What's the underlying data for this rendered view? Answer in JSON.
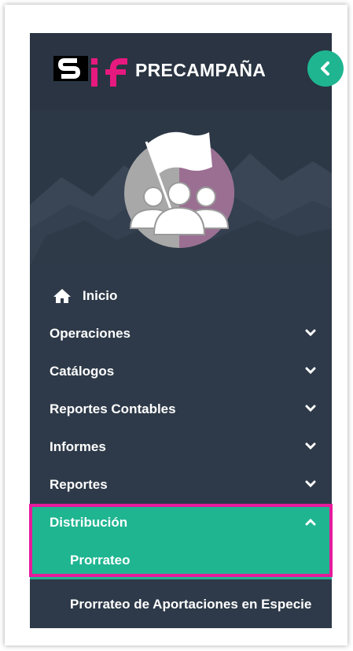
{
  "header": {
    "brand_title": "PRECAMPAÑA",
    "logo_icon": "sif-logo-icon",
    "collapse_icon": "chevron-left-icon"
  },
  "hero": {
    "icon": "flag-with-people-icon"
  },
  "menu": {
    "items": [
      {
        "label": "Inicio",
        "icon": "home-icon"
      },
      {
        "label": "Operaciones",
        "icon": "chevron-down-icon"
      },
      {
        "label": "Catálogos",
        "icon": "chevron-down-icon"
      },
      {
        "label": "Reportes Contables",
        "icon": "chevron-down-icon"
      },
      {
        "label": "Informes",
        "icon": "chevron-down-icon"
      },
      {
        "label": "Reportes",
        "icon": "chevron-down-icon"
      },
      {
        "label": "Distribución",
        "icon": "chevron-up-icon"
      }
    ],
    "subitems": [
      {
        "label": "Prorrateo"
      },
      {
        "label": "Prorrateo de Aportaciones en Especie"
      }
    ]
  },
  "colors": {
    "sidebar_bg": "#2e3a49",
    "accent": "#1fb591",
    "highlight_border": "#e61a9c",
    "logo_pink": "#e6197f"
  }
}
